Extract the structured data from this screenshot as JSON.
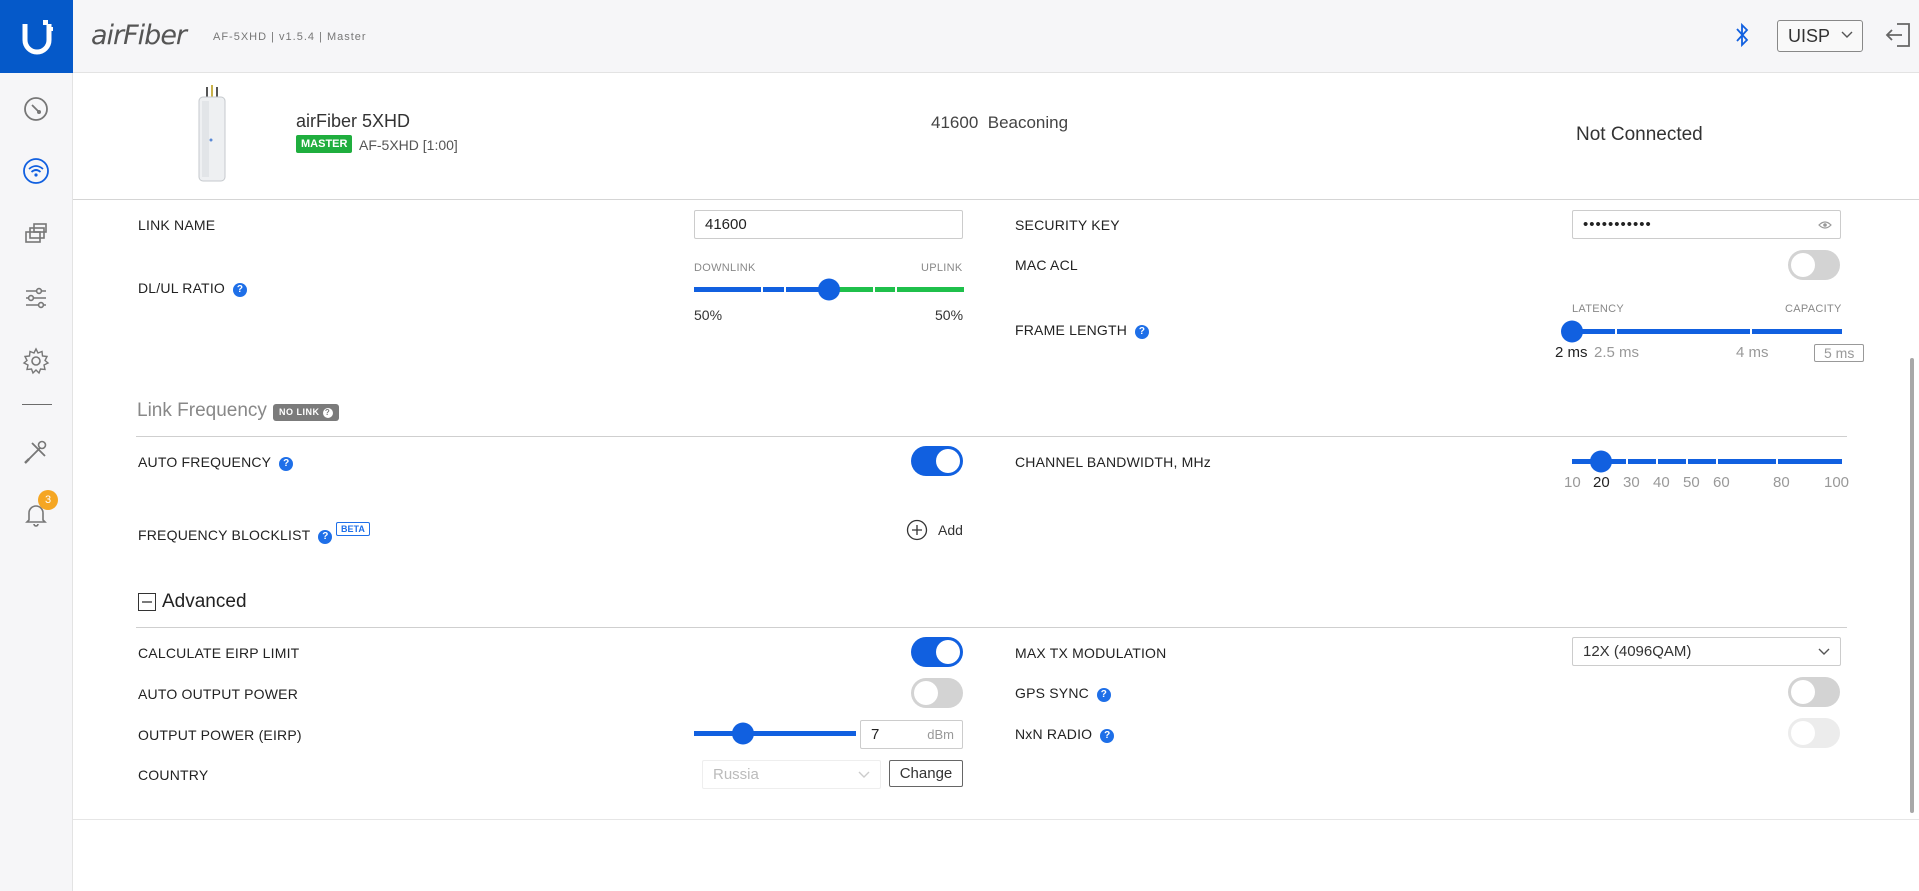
{
  "header": {
    "brand": "airFiber",
    "firmware_info": "AF-5XHD | v1.5.4 | Master",
    "uisp_label": "UISP"
  },
  "notifications": {
    "count": "3"
  },
  "device": {
    "name": "airFiber 5XHD",
    "role_badge": "MASTER",
    "model": "AF-5XHD [1:00]",
    "link_name_value": "41600",
    "link_state": "Beaconing",
    "connection": "Not Connected"
  },
  "link": {
    "link_name_label": "LINK NAME",
    "link_name_value": "41600",
    "security_key_label": "SECURITY KEY",
    "security_key_value": "•••••••••••",
    "dlul_label": "DL/UL RATIO",
    "downlink_cap": "DOWNLINK",
    "uplink_cap": "UPLINK",
    "dl_pct": "50%",
    "ul_pct": "50%",
    "dl_ratio": 0.5,
    "mac_acl_label": "MAC ACL",
    "mac_acl_on": false,
    "frame_length_label": "FRAME LENGTH",
    "latency_cap": "LATENCY",
    "capacity_cap": "CAPACITY",
    "frame_ticks": [
      "2 ms",
      "2.5 ms",
      "4 ms",
      "5 ms"
    ],
    "frame_selected": "2 ms"
  },
  "frequency": {
    "section_title": "Link Frequency",
    "no_link_badge": "NO LINK",
    "auto_freq_label": "AUTO FREQUENCY",
    "auto_freq_on": true,
    "channel_bw_label": "CHANNEL BANDWIDTH, MHz",
    "bw_ticks": [
      "10",
      "20",
      "30",
      "40",
      "50",
      "60",
      "80",
      "100"
    ],
    "bw_selected": "20",
    "blocklist_label": "FREQUENCY BLOCKLIST",
    "beta_badge": "BETA",
    "add_label": "Add"
  },
  "advanced": {
    "section_title": "Advanced",
    "eirp_limit_label": "CALCULATE EIRP LIMIT",
    "eirp_limit_on": true,
    "auto_power_label": "AUTO OUTPUT POWER",
    "auto_power_on": false,
    "output_power_label": "OUTPUT POWER (EIRP)",
    "output_power_value": "7",
    "output_power_unit": "dBm",
    "output_power_fraction": 0.3,
    "country_label": "COUNTRY",
    "country_value": "Russia",
    "change_label": "Change",
    "max_tx_label": "MAX TX MODULATION",
    "max_tx_value": "12X (4096QAM)",
    "gps_sync_label": "GPS SYNC",
    "gps_sync_on": false,
    "nxn_label": "NxN RADIO",
    "nxn_on": false
  },
  "colors": {
    "primary": "#1160e0",
    "uplink_green": "#1fc04b",
    "master_badge": "#1fae3e",
    "notification": "#f5a623",
    "logo_bg": "#0559c9"
  }
}
